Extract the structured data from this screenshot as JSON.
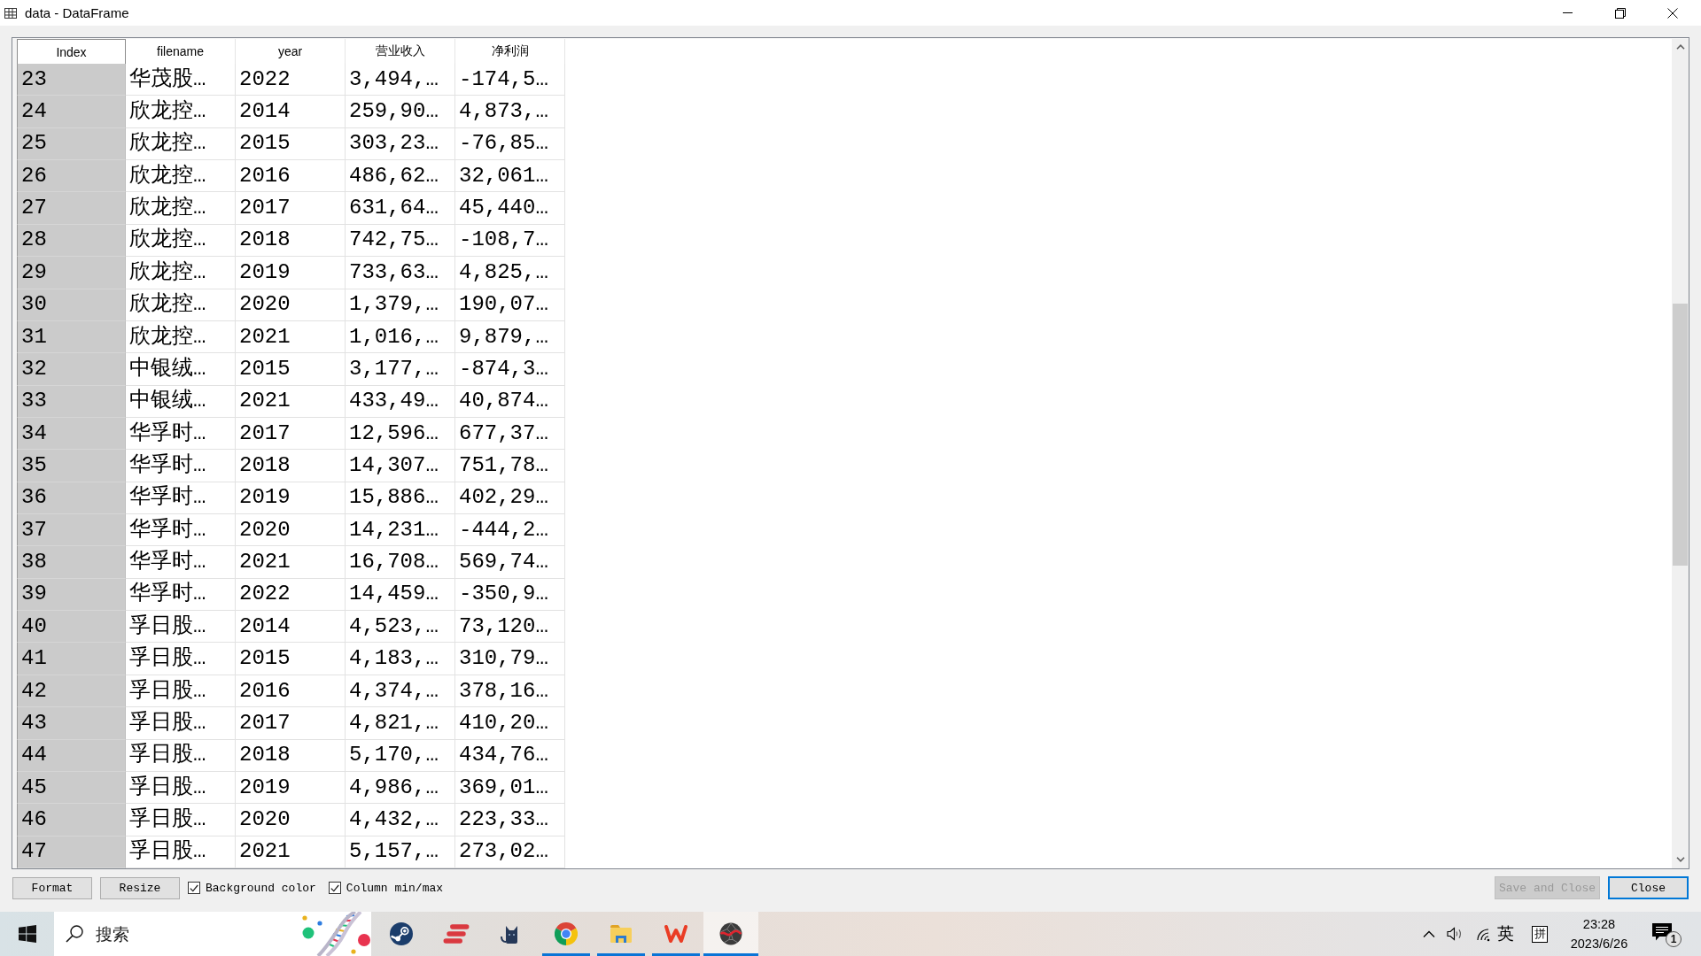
{
  "window": {
    "title": "data - DataFrame"
  },
  "table": {
    "columns": [
      {
        "label": "Index",
        "kind": "index"
      },
      {
        "label": "filename",
        "kind": "data"
      },
      {
        "label": "year",
        "kind": "data"
      },
      {
        "label": "营业收入",
        "kind": "data"
      },
      {
        "label": "净利润",
        "kind": "data"
      }
    ],
    "rows": [
      {
        "cells": [
          "23",
          "华茂股…",
          "2022",
          "3,494,…",
          "-174,5…"
        ]
      },
      {
        "cells": [
          "24",
          "欣龙控…",
          "2014",
          "259,90…",
          "4,873,…"
        ]
      },
      {
        "cells": [
          "25",
          "欣龙控…",
          "2015",
          "303,23…",
          "-76,85…"
        ]
      },
      {
        "cells": [
          "26",
          "欣龙控…",
          "2016",
          "486,62…",
          "32,061…"
        ]
      },
      {
        "cells": [
          "27",
          "欣龙控…",
          "2017",
          "631,64…",
          "45,440…"
        ]
      },
      {
        "cells": [
          "28",
          "欣龙控…",
          "2018",
          "742,75…",
          "-108,7…"
        ]
      },
      {
        "cells": [
          "29",
          "欣龙控…",
          "2019",
          "733,63…",
          "4,825,…"
        ]
      },
      {
        "cells": [
          "30",
          "欣龙控…",
          "2020",
          "1,379,…",
          "190,07…"
        ]
      },
      {
        "cells": [
          "31",
          "欣龙控…",
          "2021",
          "1,016,…",
          "9,879,…"
        ]
      },
      {
        "cells": [
          "32",
          "中银绒…",
          "2015",
          "3,177,…",
          "-874,3…"
        ]
      },
      {
        "cells": [
          "33",
          "中银绒…",
          "2021",
          "433,49…",
          "40,874…"
        ]
      },
      {
        "cells": [
          "34",
          "华孚时…",
          "2017",
          "12,596…",
          "677,37…"
        ]
      },
      {
        "cells": [
          "35",
          "华孚时…",
          "2018",
          "14,307…",
          "751,78…"
        ]
      },
      {
        "cells": [
          "36",
          "华孚时…",
          "2019",
          "15,886…",
          "402,29…"
        ]
      },
      {
        "cells": [
          "37",
          "华孚时…",
          "2020",
          "14,231…",
          "-444,2…"
        ]
      },
      {
        "cells": [
          "38",
          "华孚时…",
          "2021",
          "16,708…",
          "569,74…"
        ]
      },
      {
        "cells": [
          "39",
          "华孚时…",
          "2022",
          "14,459…",
          "-350,9…"
        ]
      },
      {
        "cells": [
          "40",
          "孚日股…",
          "2014",
          "4,523,…",
          "73,120…"
        ]
      },
      {
        "cells": [
          "41",
          "孚日股…",
          "2015",
          "4,183,…",
          "310,79…"
        ]
      },
      {
        "cells": [
          "42",
          "孚日股…",
          "2016",
          "4,374,…",
          "378,16…"
        ]
      },
      {
        "cells": [
          "43",
          "孚日股…",
          "2017",
          "4,821,…",
          "410,20…"
        ]
      },
      {
        "cells": [
          "44",
          "孚日股…",
          "2018",
          "5,170,…",
          "434,76…"
        ]
      },
      {
        "cells": [
          "45",
          "孚日股…",
          "2019",
          "4,986,…",
          "369,01…"
        ]
      },
      {
        "cells": [
          "46",
          "孚日股…",
          "2020",
          "4,432,…",
          "223,33…"
        ]
      },
      {
        "cells": [
          "47",
          "孚日股…",
          "2021",
          "5,157,…",
          "273,02…"
        ]
      }
    ]
  },
  "toolbar": {
    "buttons": [
      "Format",
      "Resize"
    ],
    "checkboxes": [
      {
        "label": "Background color",
        "checked": true
      },
      {
        "label": "Column min/max",
        "checked": true
      }
    ]
  },
  "dialog_buttons": [
    {
      "label": "Save and Close",
      "disabled": true,
      "focused": false
    },
    {
      "label": "Close",
      "disabled": false,
      "focused": true
    }
  ],
  "taskbar": {
    "search": {
      "placeholder": "搜索"
    },
    "apps": [
      {
        "kind": "disc",
        "running": false,
        "selected": false
      },
      {
        "kind": "stripes",
        "running": false,
        "selected": false
      },
      {
        "kind": "cat",
        "running": false,
        "selected": false
      },
      {
        "kind": "ring",
        "running": true,
        "selected": false
      },
      {
        "kind": "folder",
        "running": true,
        "selected": false
      },
      {
        "kind": "zigzag",
        "running": true,
        "selected": false
      },
      {
        "kind": "ball",
        "running": true,
        "selected": true
      }
    ],
    "tray": {
      "input_language": "英",
      "ime_mode": "拼",
      "time": "23:28",
      "date": "2023/6/26",
      "notifications": "1"
    }
  }
}
